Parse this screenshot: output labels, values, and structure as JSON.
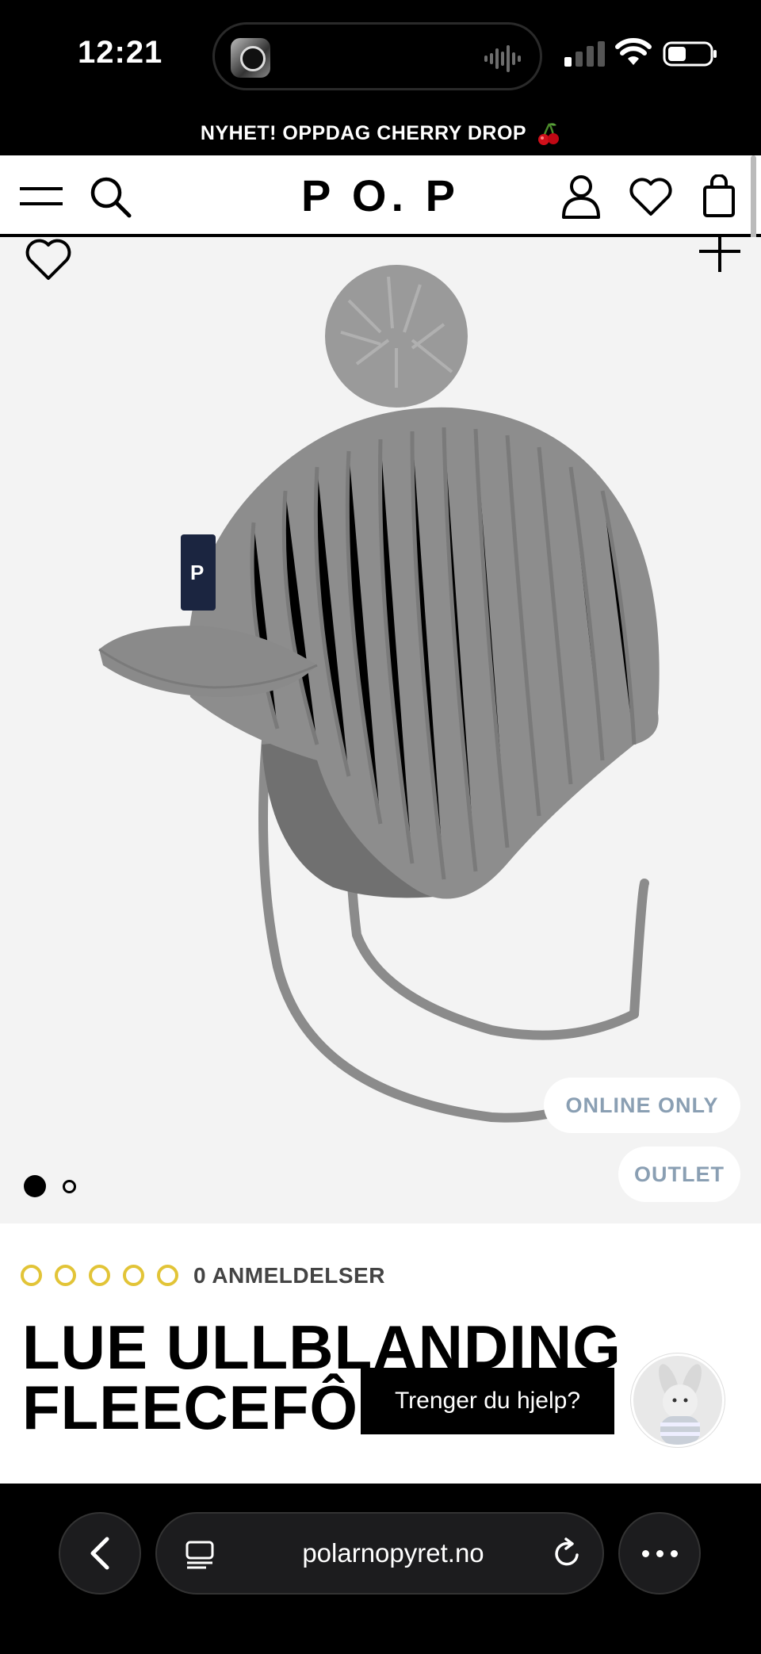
{
  "status_bar": {
    "time": "12:21"
  },
  "promo": {
    "text": "NYHET! OPPDAG CHERRY DROP"
  },
  "header": {
    "logo": "P O. P",
    "icons": [
      "menu-icon",
      "search-icon",
      "account-icon",
      "heart-icon",
      "bag-icon"
    ]
  },
  "gallery": {
    "badges": [
      "ONLINE ONLY",
      "OUTLET"
    ],
    "slide_count": 2,
    "active_slide": 1
  },
  "product": {
    "rating": 0,
    "rating_max": 5,
    "reviews_label": "0 ANMELDELSER",
    "title_line1": "LUE ULLBLANDING",
    "title_line2": "FLEECEFÔR"
  },
  "chat": {
    "help_label": "Trenger du hjelp?"
  },
  "browser": {
    "url": "polarnopyret.no"
  },
  "colors": {
    "star": "#e2c437",
    "badge_text": "#8a9fb3",
    "gallery_bg": "#f3f3f3",
    "hat": "#8d8d8d"
  }
}
